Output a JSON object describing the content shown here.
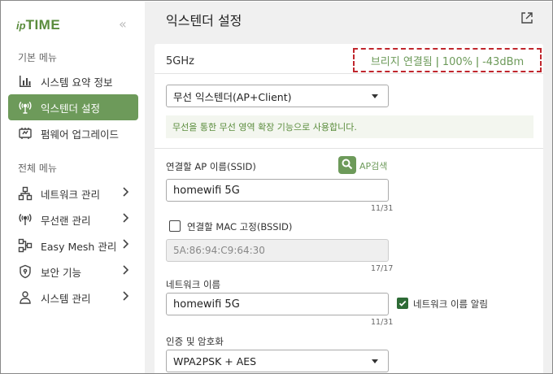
{
  "logo": {
    "prefix": "ip",
    "name": "TIME"
  },
  "sidebar": {
    "collapse_glyph": "«",
    "section_basic": "기본 메뉴",
    "basic_items": [
      {
        "label": "시스템 요약 정보",
        "icon": "bar-chart-icon"
      },
      {
        "label": "익스텐더 설정",
        "icon": "wireless-tower-icon",
        "active": true
      },
      {
        "label": "펌웨어 업그레이드",
        "icon": "firmware-icon"
      }
    ],
    "section_all": "전체 메뉴",
    "all_items": [
      {
        "label": "네트워크 관리",
        "icon": "network-icon"
      },
      {
        "label": "무선랜 관리",
        "icon": "wireless-icon"
      },
      {
        "label": "Easy Mesh 관리",
        "icon": "mesh-icon"
      },
      {
        "label": "보안 기능",
        "icon": "shield-icon"
      },
      {
        "label": "시스템 관리",
        "icon": "system-icon"
      }
    ]
  },
  "main": {
    "title": "익스텐더 설정",
    "band": "5GHz",
    "status": "브리지 연결됨 ǀ 100% ǀ -43dBm",
    "mode_select": "무선 익스텐더(AP+Client)",
    "info": "무선을 통한 무선 영역 확장 기능으로 사용합니다.",
    "ssid_label": "연결할 AP 이름(SSID)",
    "ap_search_label": "AP검색",
    "ssid_value": "homewifi 5G",
    "ssid_counter": "11/31",
    "mac_fix_label": "연결할 MAC 고정(BSSID)",
    "mac_value": "5A:86:94:C9:64:30",
    "mac_counter": "17/17",
    "network_name_label": "네트워크 이름",
    "network_name_value": "homewifi 5G",
    "network_name_counter": "11/31",
    "announce_label": "네트워크 이름 알림",
    "auth_label": "인증 및 암호화",
    "auth_select": "WPA2PSK + AES"
  },
  "colors": {
    "accent": "#6d9a5a",
    "status_border": "#c0262d",
    "checkbox_checked": "#2e6b36"
  }
}
